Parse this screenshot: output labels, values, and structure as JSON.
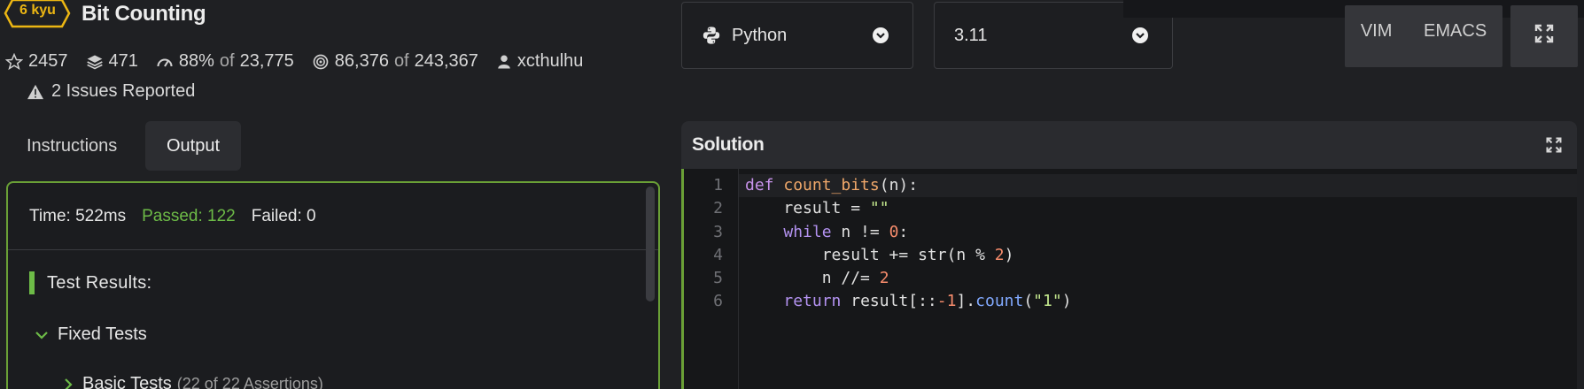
{
  "kata": {
    "rank": "6 kyu",
    "title": "Bit Counting",
    "stats": {
      "stars": "2457",
      "collections": "471",
      "satisfaction": "88%",
      "satisfaction_of": "of",
      "satisfaction_total": "23,775",
      "completions": "86,376",
      "completions_of": "of",
      "completions_total": "243,367",
      "author": "xcthulhu"
    },
    "issues": "2 Issues Reported"
  },
  "tabs": [
    {
      "label": "Instructions"
    },
    {
      "label": "Output"
    }
  ],
  "output": {
    "time": "Time: 522ms",
    "passed": "Passed: 122",
    "failed": "Failed: 0",
    "test_results_label": "Test Results:",
    "fixed_tests_label": "Fixed Tests",
    "basic_tests_label": "Basic Tests",
    "basic_tests_assertions": "(22 of 22 Assertions)"
  },
  "language_select": {
    "value": "Python"
  },
  "version_select": {
    "value": "3.11"
  },
  "editor_modes": {
    "vim": "VIM",
    "emacs": "EMACS"
  },
  "solution": {
    "title": "Solution",
    "lines": [
      {
        "n": "1"
      },
      {
        "n": "2"
      },
      {
        "n": "3"
      },
      {
        "n": "4"
      },
      {
        "n": "5"
      },
      {
        "n": "6"
      }
    ],
    "tokens": {
      "l1_def": "def",
      "l1_name": "count_bits",
      "l1_rest": "(n):",
      "l2_a": "    result = ",
      "l2_str": "\"\"",
      "l3_kw": "while",
      "l3_a": " n != ",
      "l3_num": "0",
      "l3_b": ":",
      "l4_a": "        result += str(n % ",
      "l4_num": "2",
      "l4_b": ")",
      "l5_a": "        n //= ",
      "l5_num": "2",
      "l6_kw": "return",
      "l6_a": " result[::",
      "l6_num": "-1",
      "l6_b": "].",
      "l6_meth": "count",
      "l6_c": "(",
      "l6_str": "\"1\"",
      "l6_d": ")"
    }
  },
  "colors": {
    "accent_green": "#6aa036",
    "rank_yellow": "#ecb613",
    "passed_green": "#6dbb47"
  }
}
